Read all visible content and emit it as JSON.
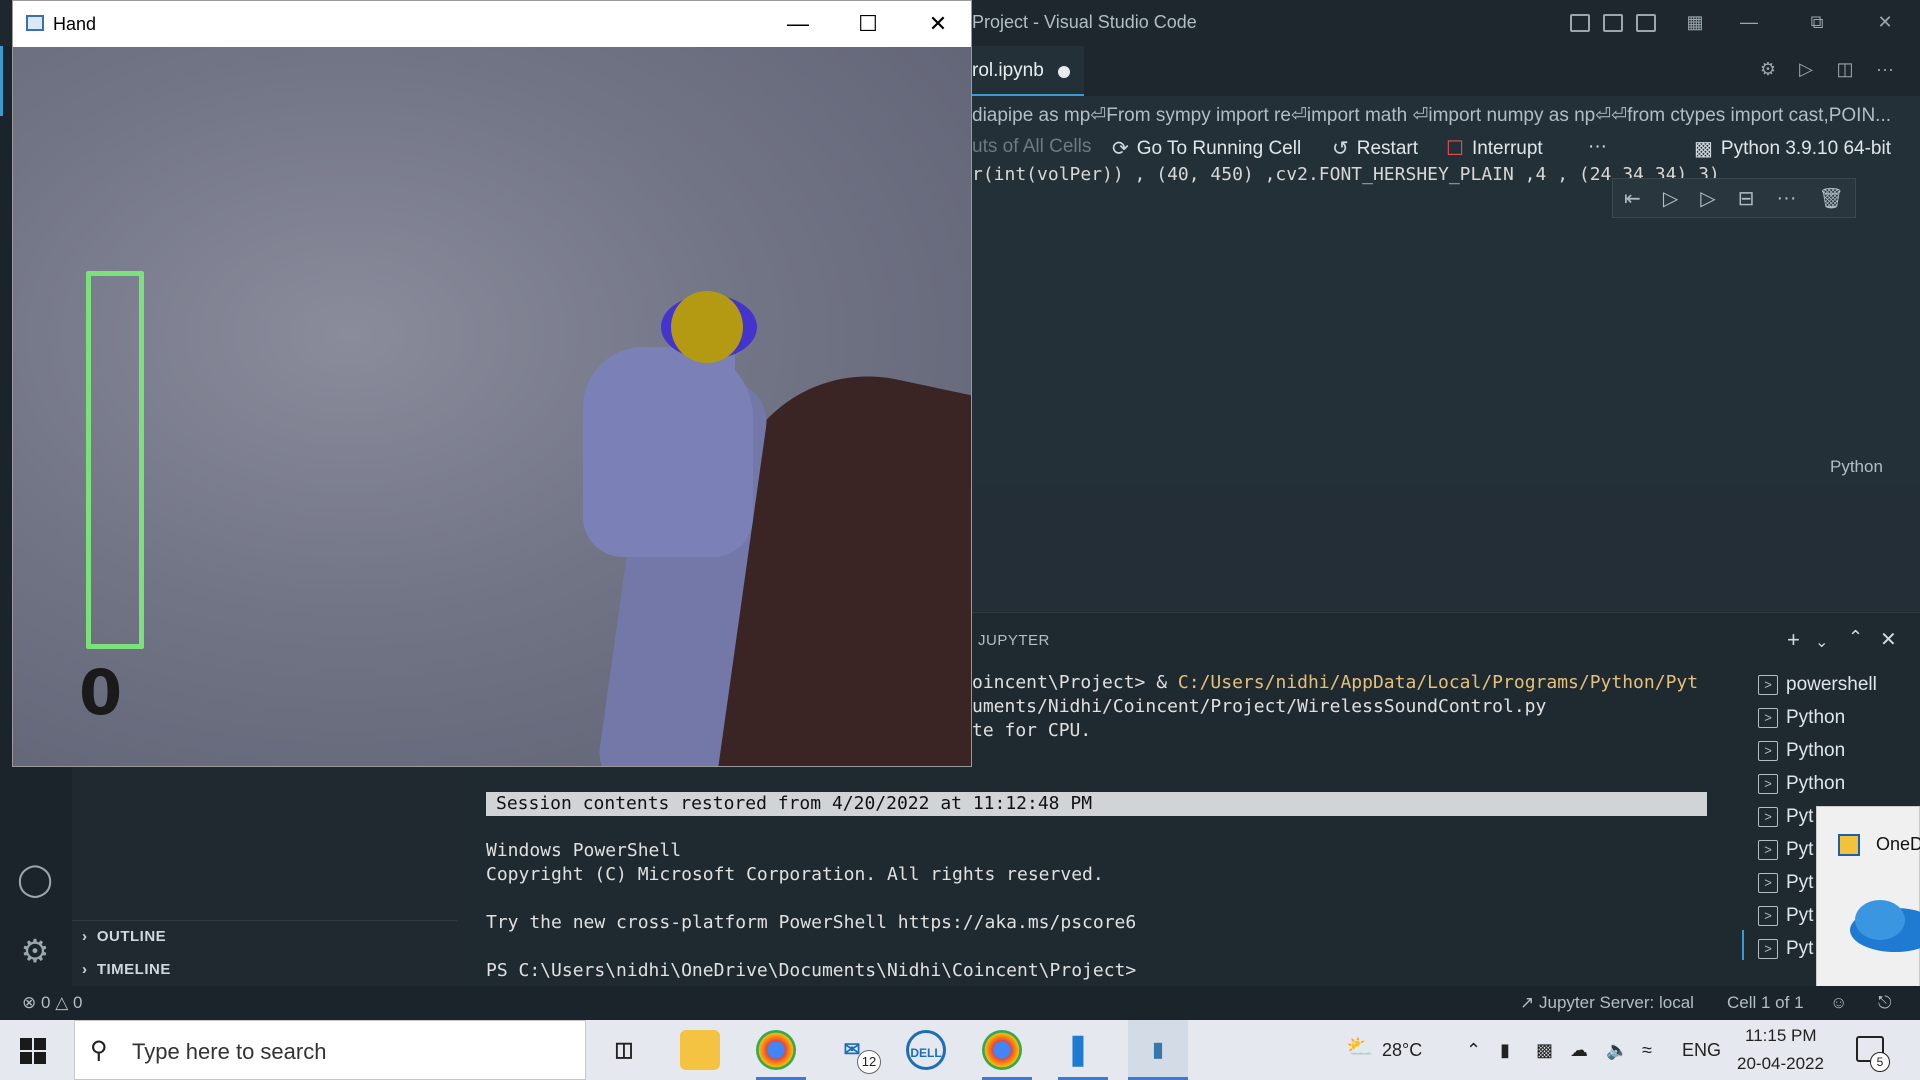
{
  "vscode": {
    "title": "Project - Visual Studio Code",
    "tab_label": "rol.ipynb",
    "breadcrumb": "diapipe as mp⏎From sympy import re⏎import math ⏎import numpy as np⏎⏎from ctypes import cast,POIN...",
    "toolbar": {
      "faded": "uts of All Cells",
      "go_to_running": "Go To Running Cell",
      "restart": "Restart",
      "interrupt": "Interrupt",
      "more": "···",
      "kernel": "Python 3.9.10 64-bit"
    },
    "code_line": "r(int(volPer)) , (40, 450) ,cv2.FONT_HERSHEY_PLAIN ,4 , (24 34 34)  3)",
    "cell_language": "Python",
    "sidebar": {
      "outline": "OUTLINE",
      "timeline": "TIMELINE"
    },
    "panel": {
      "tab": "JUPYTER",
      "terminal_lines": [
        {
          "prefix": "oincent\\Project> & ",
          "highlight": "C:/Users/nidhi/AppData/Local/Programs/Python/Pyt"
        },
        {
          "prefix": "uments/Nidhi/Coincent/Project/WirelessSoundControl.py",
          "highlight": ""
        },
        {
          "prefix": "te for CPU.",
          "highlight": ""
        }
      ],
      "banner": "Session contents restored from 4/20/2022 at 11:12:48 PM",
      "ps_title": "Windows PowerShell",
      "copyright": "Copyright (C) Microsoft Corporation. All rights reserved.",
      "try_new": "Try the new cross-platform PowerShell https://aka.ms/pscore6",
      "prompt": "PS C:\\Users\\nidhi\\OneDrive\\Documents\\Nidhi\\Coincent\\Project>",
      "terminals": [
        "powershell",
        "Python",
        "Python",
        "Python",
        "Pyt",
        "Pyt",
        "Pyt",
        "Pyt",
        "Pyt"
      ]
    },
    "onedrive_label": "OneD",
    "status": {
      "errors": "0",
      "warnings": "0",
      "jupyter_server": "Jupyter Server: local",
      "cell": "Cell 1 of 1"
    }
  },
  "hand_window": {
    "title": "Hand",
    "volume_text": "0",
    "volume_percent": 0
  },
  "taskbar": {
    "search_placeholder": "Type here to search",
    "mail_badge": "12",
    "weather": "28°C",
    "language": "ENG",
    "time": "11:15 PM",
    "date": "20-04-2022",
    "notifications": "5"
  }
}
